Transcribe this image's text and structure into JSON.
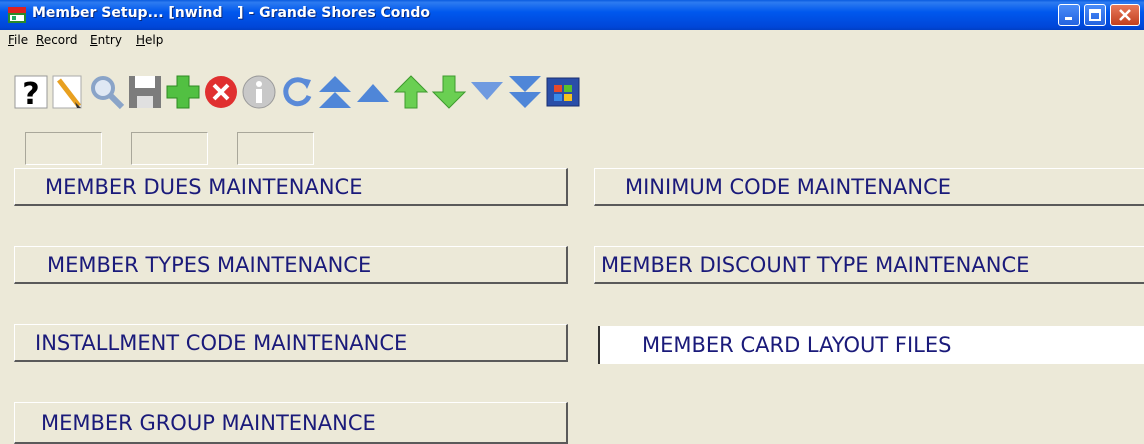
{
  "window": {
    "title": "Member Setup... [nwind   ] - Grande Shores Condo"
  },
  "menubar": {
    "items": [
      {
        "label": "File",
        "accel": "F",
        "rest": "ile"
      },
      {
        "label": "Record",
        "accel": "R",
        "rest": "ecord"
      },
      {
        "label": "Entry",
        "accel": "E",
        "rest": "ntry"
      },
      {
        "label": "Help",
        "accel": "H",
        "rest": "elp"
      }
    ]
  },
  "toolbar": {
    "buttons": [
      {
        "icon": "help-icon"
      },
      {
        "icon": "new-document-icon"
      },
      {
        "icon": "search-icon"
      },
      {
        "icon": "save-icon"
      },
      {
        "icon": "add-icon"
      },
      {
        "icon": "delete-icon"
      },
      {
        "icon": "info-icon"
      },
      {
        "icon": "refresh-icon"
      },
      {
        "icon": "first-record-icon"
      },
      {
        "icon": "previous-page-icon"
      },
      {
        "icon": "previous-record-icon"
      },
      {
        "icon": "next-record-icon"
      },
      {
        "icon": "next-page-icon"
      },
      {
        "icon": "last-record-icon"
      },
      {
        "icon": "windows-icon"
      }
    ]
  },
  "buttons": {
    "member_dues": "MEMBER DUES MAINTENANCE",
    "minimum_code": "MINIMUM CODE MAINTENANCE",
    "member_types": "MEMBER TYPES MAINTENANCE",
    "member_discount_type": "MEMBER DISCOUNT TYPE MAINTENANCE",
    "installment_code": "INSTALLMENT CODE MAINTENANCE",
    "member_card_layout": "MEMBER CARD LAYOUT FILES",
    "member_group": "MEMBER GROUP MAINTENANCE"
  },
  "colors": {
    "titlebar": "#0054e3",
    "button_text": "#1a1a7a",
    "background": "#ece9d8"
  }
}
